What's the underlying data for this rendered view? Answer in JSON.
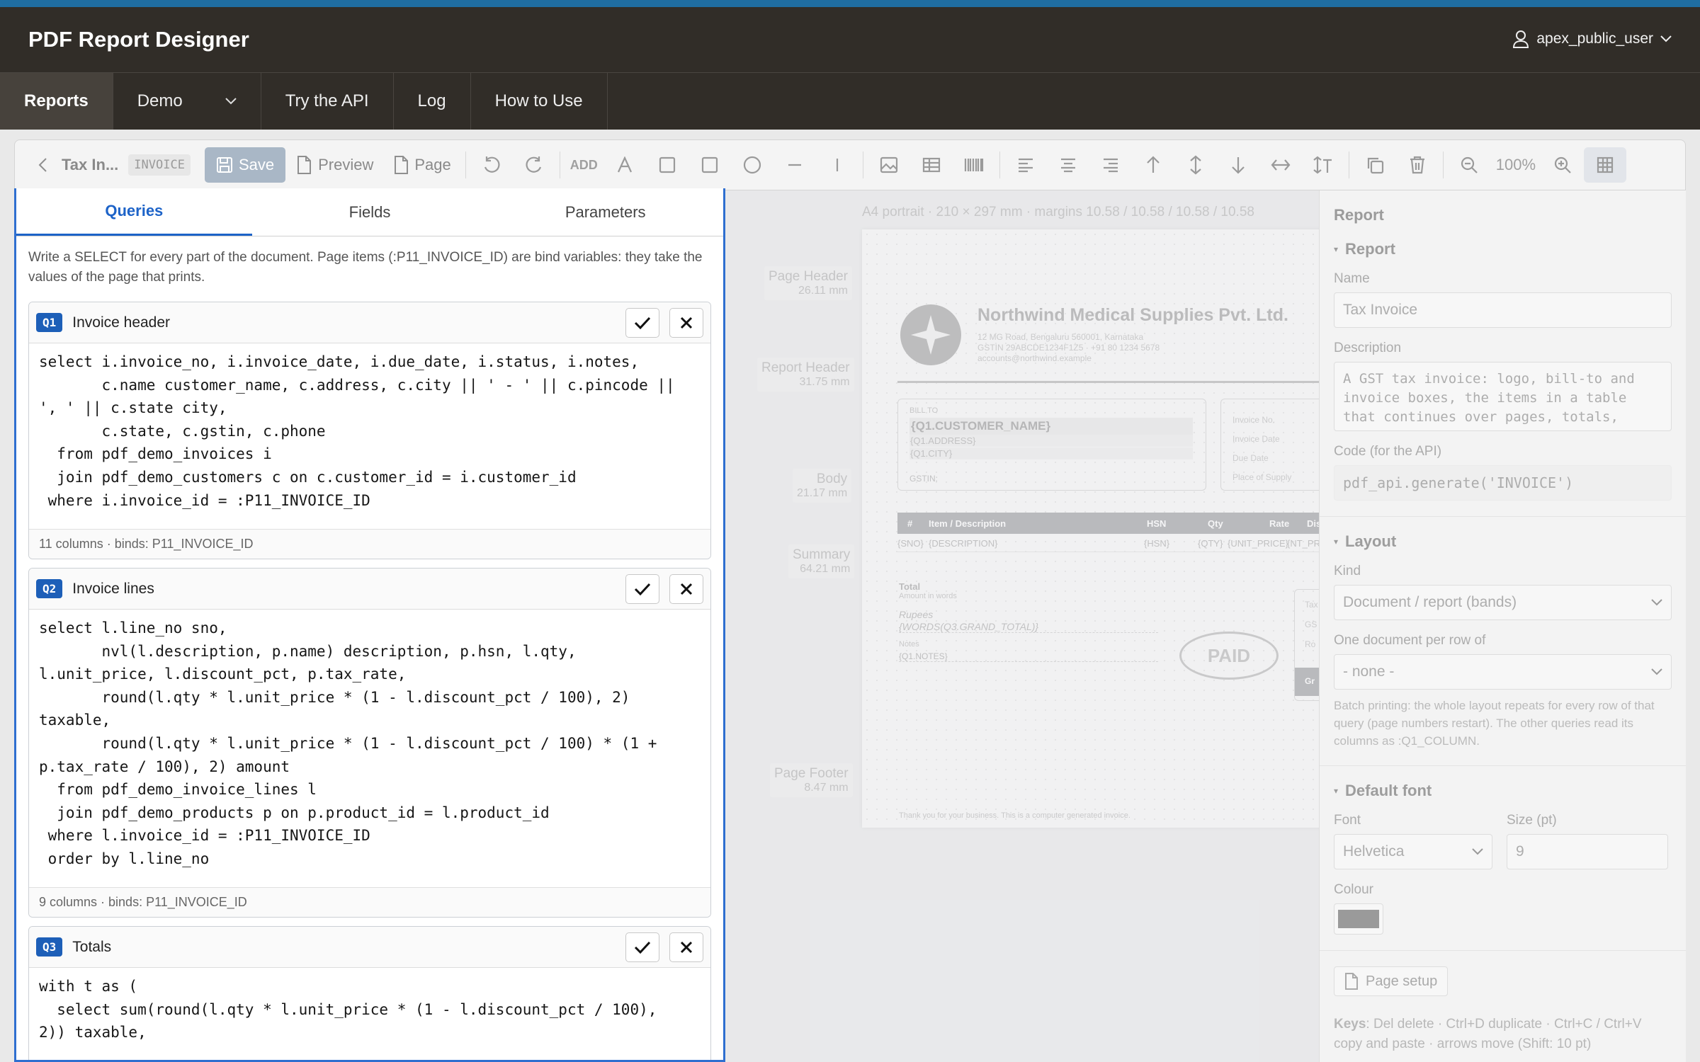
{
  "app": {
    "title": "PDF Report Designer",
    "user": "apex_public_user"
  },
  "nav": {
    "tabs": [
      "Reports",
      "Demo",
      "Try the API",
      "Log",
      "How to Use"
    ]
  },
  "toolbar": {
    "report_name": "Tax In...",
    "report_kind": "INVOICE",
    "save": "Save",
    "preview": "Preview",
    "page": "Page",
    "add": "ADD",
    "zoom": "100%"
  },
  "left": {
    "tabs": [
      "Queries",
      "Fields",
      "Parameters"
    ],
    "intro": "Write a SELECT for every part of the document. Page items (:P11_INVOICE_ID) are bind variables: they take the values of the page that prints.",
    "queries": [
      {
        "badge": "Q1",
        "name": "Invoice header",
        "code": "select i.invoice_no, i.invoice_date, i.due_date, i.status, i.notes,\n       c.name customer_name, c.address, c.city || ' - ' || c.pincode ||\n', ' || c.state city,\n       c.state, c.gstin, c.phone\n  from pdf_demo_invoices i\n  join pdf_demo_customers c on c.customer_id = i.customer_id\n where i.invoice_id = :P11_INVOICE_ID",
        "footer": "11 columns · binds: P11_INVOICE_ID"
      },
      {
        "badge": "Q2",
        "name": "Invoice lines",
        "code": "select l.line_no sno,\n       nvl(l.description, p.name) description, p.hsn, l.qty,\nl.unit_price, l.discount_pct, p.tax_rate,\n       round(l.qty * l.unit_price * (1 - l.discount_pct / 100), 2)\ntaxable,\n       round(l.qty * l.unit_price * (1 - l.discount_pct / 100) * (1 +\np.tax_rate / 100), 2) amount\n  from pdf_demo_invoice_lines l\n  join pdf_demo_products p on p.product_id = l.product_id\n where l.invoice_id = :P11_INVOICE_ID\n order by l.line_no",
        "footer": "9 columns · binds: P11_INVOICE_ID"
      },
      {
        "badge": "Q3",
        "name": "Totals",
        "code": "with t as (\n  select sum(round(l.qty * l.unit_price * (1 - l.discount_pct / 100),\n2)) taxable,"
      }
    ]
  },
  "canvas": {
    "page_meta": "A4 portrait · 210 × 297 mm · margins 10.58 / 10.58 / 10.58 / 10.58",
    "bands": [
      {
        "name": "Page Header",
        "size": "26.11 mm"
      },
      {
        "name": "Report Header",
        "size": "31.75 mm"
      },
      {
        "name": "Body",
        "size": "21.17 mm"
      },
      {
        "name": "Summary",
        "size": "64.21 mm"
      },
      {
        "name": "Page Footer",
        "size": "8.47 mm"
      }
    ],
    "company": "Northwind Medical Supplies Pvt. Ltd.",
    "company_addr1": "12 MG Road, Bengaluru 560001, Karnataka",
    "company_addr2": "GSTIN 29ABCDE1234F1Z5 · +91 80 1234 5678",
    "company_email": "accounts@northwind.example",
    "bill_to": "BILL TO",
    "cust_name": "{Q1.CUSTOMER_NAME}",
    "cust_addr": "{Q1.ADDRESS}",
    "cust_city": "{Q1.CITY}",
    "gstin": "GSTIN:",
    "inv_labels": [
      "Invoice No.",
      "Invoice Date",
      "Due Date",
      "Place of Supply"
    ],
    "table_cols": [
      "#",
      "Item / Description",
      "HSN",
      "Qty",
      "Rate",
      "Disc"
    ],
    "table_row": [
      "{SNO}",
      "{DESCRIPTION}",
      "{HSN}",
      "{QTY}",
      "{UNIT_PRICE}",
      "{NT_PR"
    ],
    "total": "Total",
    "amount_words": "Amount in words",
    "rupees": "Rupees",
    "words": "{WORDS(Q3.GRAND_TOTAL)}",
    "notes": "Notes",
    "notes_val": "{Q1.NOTES}",
    "paid": "PAID",
    "summary_box": [
      "Tax",
      "GS",
      "Ro",
      "Gr"
    ],
    "footer": "Thank you for your business. This is a computer generated invoice."
  },
  "right": {
    "title": "Report",
    "sec_report": "Report",
    "name_label": "Name",
    "name_value": "Tax Invoice",
    "desc_label": "Description",
    "desc_value": "A GST tax invoice: logo, bill-to and\ninvoice boxes, the items in a table\nthat continues over pages, totals,\n                 ",
    "code_label": "Code (for the API)",
    "code_value": "pdf_api.generate('INVOICE')",
    "sec_layout": "Layout",
    "kind_label": "Kind",
    "kind_value": "Document / report (bands)",
    "per_row_label": "One document per row of",
    "per_row_value": "- none -",
    "per_row_hint": "Batch printing: the whole layout repeats for every row of that query (page numbers restart). The other queries read its columns as :Q1_COLUMN.",
    "sec_font": "Default font",
    "font_label": "Font",
    "font_value": "Helvetica",
    "size_label": "Size (pt)",
    "size_value": "9",
    "colour_label": "Colour",
    "page_setup": "Page setup",
    "keys_label": "Keys",
    "keys_text": ": Del delete · Ctrl+D duplicate · Ctrl+C / Ctrl+V copy and paste · arrows move (Shift: 10 pt)"
  },
  "colors": {
    "header": "#312d28",
    "accent": "#1f6da1",
    "primary": "#1d63c8"
  }
}
